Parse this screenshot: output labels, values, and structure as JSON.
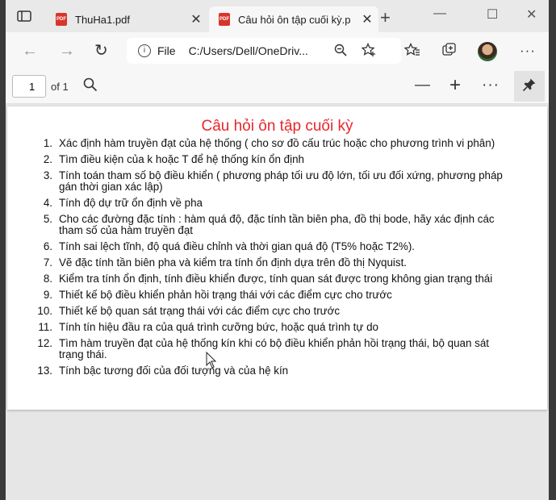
{
  "tabs": [
    {
      "title": "ThuHa1.pdf",
      "badge": "PDF"
    },
    {
      "title": "Câu hỏi ôn tập cuối kỳ.p",
      "badge": "PDF"
    }
  ],
  "address": {
    "scheme_label": "File",
    "url": "C:/Users/Dell/OneDriv..."
  },
  "pdf_toolbar": {
    "page": "1",
    "of_label": "of 1"
  },
  "document": {
    "title": "Câu hỏi ôn tập cuối kỳ",
    "questions": [
      {
        "n": "1.",
        "text": "Xác định hàm truyền đạt của hệ thống ( cho sơ đồ cấu trúc hoặc cho phương trình vi phân)"
      },
      {
        "n": "2.",
        "text": "Tìm điều kiện của k hoặc T để hệ thống kín ổn định"
      },
      {
        "n": "3.",
        "text": "Tính toán tham số bộ điều khiển ( phương pháp tối ưu độ lớn, tối ưu đối xứng, phương pháp gán thời gian xác lập)"
      },
      {
        "n": "4.",
        "text": "Tính độ dự trữ ổn định về pha"
      },
      {
        "n": "5.",
        "text": "Cho các đường đặc tính : hàm quá độ, đặc tính tần biên pha, đồ thị bode, hãy xác định các tham số của hàm truyền đạt"
      },
      {
        "n": "6.",
        "text": "Tính sai lệch tĩnh, độ quá điều chỉnh và thời gian quá độ (T5% hoặc T2%)."
      },
      {
        "n": "7.",
        "text": "Vẽ đặc tính tần biên pha và kiểm tra tính ổn định dựa trên đồ thị Nyquist."
      },
      {
        "n": "8.",
        "text": "Kiểm tra tính ổn định, tính điều khiển được, tính quan sát được trong không gian trạng thái"
      },
      {
        "n": "9.",
        "text": "Thiết kế bộ điều khiển phản hồi trạng thái với các điểm cực cho trước"
      },
      {
        "n": "10.",
        "text": "Thiết kế bộ quan sát trạng thái với các điểm cực cho trước"
      },
      {
        "n": "11.",
        "text": "Tính tín hiệu đầu ra của quá trình cưỡng bức, hoặc quá trình tự do"
      },
      {
        "n": "12.",
        "text": "Tìm hàm truyền đạt của hệ thống kín khi có bộ điều khiển phản hồi trạng thái, bộ quan sát trạng thái."
      },
      {
        "n": "13.",
        "text": "Tính bậc tương đối của đối tượng và của hệ kín"
      }
    ]
  }
}
